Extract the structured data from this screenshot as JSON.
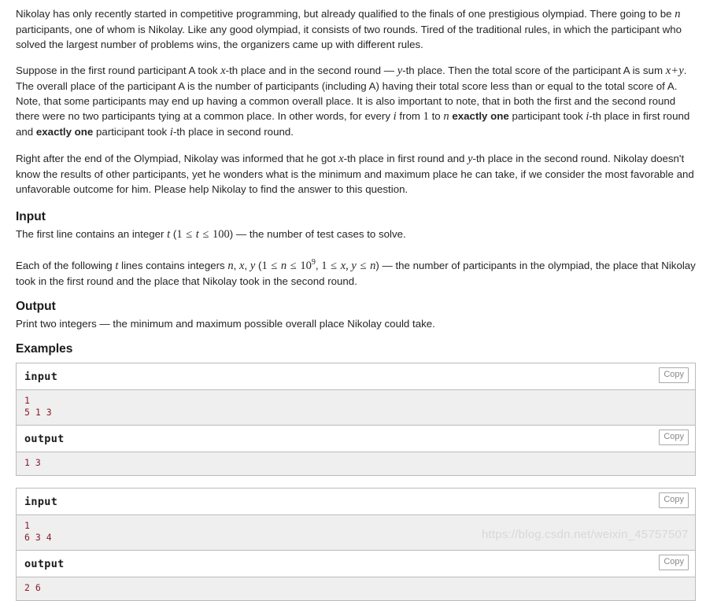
{
  "statement": {
    "paragraphs": [
      {
        "id": "p1",
        "parts": [
          {
            "t": "text",
            "v": "Nikolay has only recently started in competitive programming, but already qualified to the finals of one prestigious olympiad. There going to be "
          },
          {
            "t": "math",
            "v": "n"
          },
          {
            "t": "text",
            "v": " participants, one of whom is Nikolay. Like any good olympiad, it consists of two rounds. Tired of the traditional rules, in which the participant who solved the largest number of problems wins, the organizers came up with different rules."
          }
        ]
      },
      {
        "id": "p2",
        "parts": [
          {
            "t": "text",
            "v": "Suppose in the first round participant A took "
          },
          {
            "t": "math",
            "v": "x"
          },
          {
            "t": "text",
            "v": "-th place and in the second round — "
          },
          {
            "t": "math",
            "v": "y"
          },
          {
            "t": "text",
            "v": "-th place. Then the total score of the participant A is sum "
          },
          {
            "t": "math",
            "v": "x + y"
          },
          {
            "t": "text",
            "v": ". The overall place of the participant A is the number of participants (including A) having their total score less than or equal to the total score of A. Note, that some participants may end up having a common overall place. It is also important to note, that in both the first and the second round there were no two participants tying at a common place. In other words, for every "
          },
          {
            "t": "math",
            "v": "i"
          },
          {
            "t": "text",
            "v": " from "
          },
          {
            "t": "num",
            "v": "1"
          },
          {
            "t": "text",
            "v": " to "
          },
          {
            "t": "math",
            "v": "n"
          },
          {
            "t": "text",
            "v": " "
          },
          {
            "t": "bold",
            "v": "exactly one"
          },
          {
            "t": "text",
            "v": " participant took "
          },
          {
            "t": "math",
            "v": "i"
          },
          {
            "t": "text",
            "v": "-th place in first round and "
          },
          {
            "t": "bold",
            "v": "exactly one"
          },
          {
            "t": "text",
            "v": " participant took "
          },
          {
            "t": "math",
            "v": "i"
          },
          {
            "t": "text",
            "v": "-th place in second round."
          }
        ]
      },
      {
        "id": "p3",
        "parts": [
          {
            "t": "text",
            "v": "Right after the end of the Olympiad, Nikolay was informed that he got "
          },
          {
            "t": "math",
            "v": "x"
          },
          {
            "t": "text",
            "v": "-th place in first round and "
          },
          {
            "t": "math",
            "v": "y"
          },
          {
            "t": "text",
            "v": "-th place in the second round. Nikolay doesn't know the results of other participants, yet he wonders what is the minimum and maximum place he can take, if we consider the most favorable and unfavorable outcome for him. Please help Nikolay to find the answer to this question."
          }
        ]
      }
    ]
  },
  "input_section": {
    "heading": "Input",
    "line1": "The first line contains an integer t (1 ≤ t ≤ 100) — the number of test cases to solve.",
    "line2": "Each of the following t lines contains integers n, x, y (1 ≤ n ≤ 10^9, 1 ≤ x, y ≤ n) — the number of participants in the olympiad, the place that Nikolay took in the first round and the place that Nikolay took in the second round."
  },
  "output_section": {
    "heading": "Output",
    "line1": "Print two integers — the minimum and maximum possible overall place Nikolay could take."
  },
  "examples_section": {
    "heading": "Examples",
    "copy_label": "Copy",
    "input_label": "input",
    "output_label": "output",
    "blocks": [
      {
        "input": "1\n5 1 3",
        "output": "1 3"
      },
      {
        "input": "1\n6 3 4",
        "output": "2 6"
      }
    ]
  },
  "watermark": {
    "text": "https://blog.csdn.net/weixin_45757507"
  },
  "colors": {
    "page_bg": "#ffffff",
    "body_text": "#252525",
    "code_text": "#8b1a2b",
    "code_bg": "#efefef",
    "border": "#bbbbbb",
    "copy_text": "#888888",
    "watermark": "#d8d8d8"
  }
}
